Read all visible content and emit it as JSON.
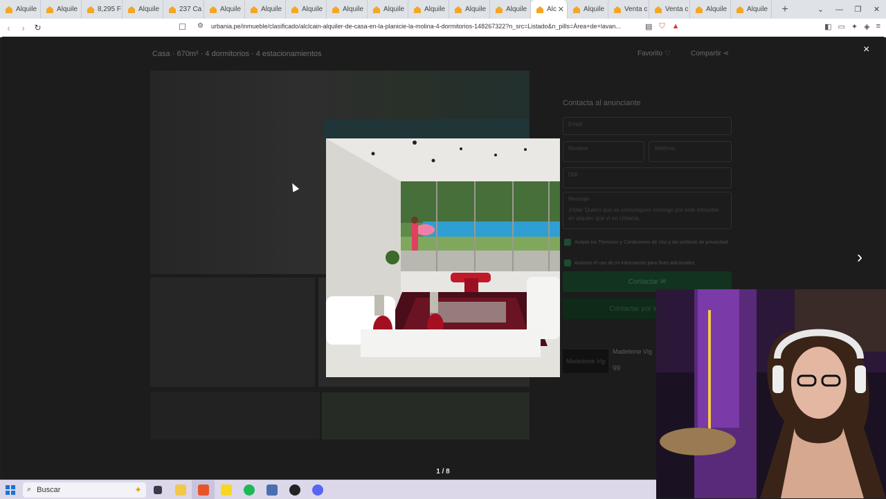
{
  "browser": {
    "tabs": [
      {
        "label": "Alquile"
      },
      {
        "label": "Alquile"
      },
      {
        "label": "8,295 F"
      },
      {
        "label": "Alquile"
      },
      {
        "label": "237 Ca"
      },
      {
        "label": "Alquile"
      },
      {
        "label": "Alquile"
      },
      {
        "label": "Alquile"
      },
      {
        "label": "Alquile"
      },
      {
        "label": "Alquile"
      },
      {
        "label": "Alquile"
      },
      {
        "label": "Alquile"
      },
      {
        "label": "Alquile"
      },
      {
        "label": "Alc",
        "active": true
      },
      {
        "label": "Alquile"
      },
      {
        "label": "Venta c"
      },
      {
        "label": "Venta c"
      },
      {
        "label": "Alquile"
      },
      {
        "label": "Alquile"
      }
    ],
    "url": "urbania.pe/inmueble/clasificado/alclcain-alquiler-de-casa-en-la-planicie-la-molina-4-dormitorios-148267322?n_src=Listado&n_pills=Área+de+lavan...",
    "new_tab": "+",
    "colors": {
      "brand_tab_icon": "#f5a623",
      "active_tab": "#ffffff"
    }
  },
  "listing": {
    "title": "Casa · 670m² · 4 dormitorios · 4 estacionamientos",
    "favorite": "Favorito ♡",
    "share": "Compartir ⋖",
    "close_icon": "×",
    "contact": {
      "title": "Contacta al anunciante",
      "email_placeholder": "Email",
      "name_placeholder": "Nombre",
      "phone_placeholder": "Teléfono",
      "dni_placeholder": "DNI",
      "message_label": "Mensaje",
      "message_text": "¡Hola! Quiero que se comuniquen conmigo por este inmueble en alquiler que vi en Urbania.",
      "terms_text": "Acepto los Términos y Condiciones de Uso y las políticas de privacidad",
      "consent_text": "Autorizo el uso de mi información para fines adicionales",
      "contact_button": "Contactar ✉",
      "whatsapp_button": "Contactar por WhatsApp"
    },
    "agent": {
      "name": "Madeleine Vig",
      "logo_text": "Madeleine Vig",
      "sub": "99"
    },
    "gallery": {
      "counter": "1 / 8",
      "next_icon": "›"
    }
  },
  "taskbar": {
    "search_label": "Buscar",
    "apps": [
      "task-view",
      "file-explorer",
      "brave",
      "sticky-notes",
      "spotify",
      "app-window",
      "obs",
      "discord"
    ]
  }
}
